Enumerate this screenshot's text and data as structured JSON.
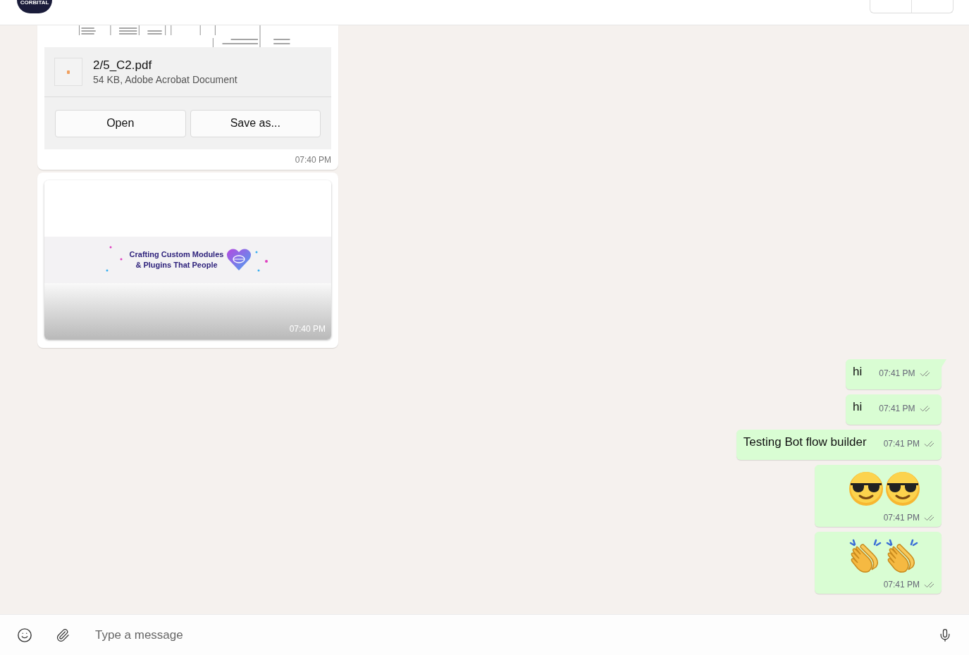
{
  "header": {
    "logo_text": "CORBITAL"
  },
  "incoming": [
    {
      "kind": "file",
      "file_name": "2/5_C2.pdf",
      "file_info": "54 KB, Adobe Acrobat Document",
      "buttons": [
        "Open",
        "Save as..."
      ],
      "time": "07:40 PM"
    },
    {
      "kind": "link_image",
      "banner_lines": [
        "Crafting Custom Modules",
        "& Plugins That People"
      ],
      "time": "07:40 PM"
    }
  ],
  "outgoing": [
    {
      "kind": "text",
      "text": "hi",
      "time": "07:41 PM",
      "tail": true
    },
    {
      "kind": "text",
      "text": "hi",
      "time": "07:41 PM",
      "tail": false
    },
    {
      "kind": "text",
      "text": "Testing Bot flow builder",
      "time": "07:41 PM",
      "tail": false
    },
    {
      "kind": "emoji",
      "emojis": [
        {
          "kind": "sunglasses"
        },
        {
          "kind": "sunglasses"
        }
      ],
      "time": "07:41 PM",
      "tail": false
    },
    {
      "kind": "emoji",
      "emojis": [
        {
          "kind": "clap"
        },
        {
          "kind": "clap"
        }
      ],
      "time": "07:41 PM",
      "tail": false
    }
  ],
  "composer": {
    "placeholder": "Type a message"
  }
}
